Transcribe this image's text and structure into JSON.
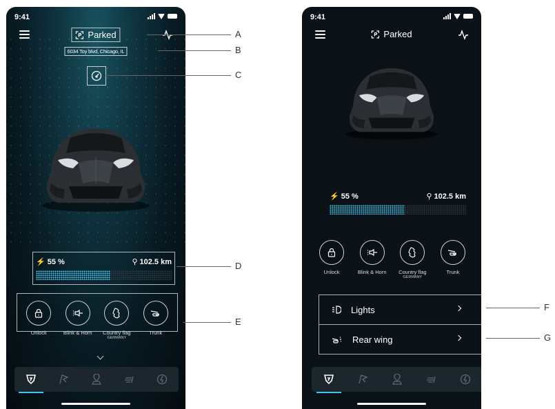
{
  "left_screen": {
    "status_bar": {
      "time": "9:41"
    },
    "header": {
      "status": "Parked",
      "address": "6034 Toy blvd, Chicago, IL"
    },
    "battery": {
      "charge": "55 %",
      "range": "102.5 km",
      "fill_fraction": 0.55
    },
    "actions": [
      {
        "label": "Unlock",
        "sub": "",
        "icon": "lock-icon"
      },
      {
        "label": "Blink & Horn",
        "sub": "",
        "icon": "horn-icon"
      },
      {
        "label": "Country flag",
        "sub": "GERMANY",
        "icon": "country-shape-icon"
      },
      {
        "label": "Trunk",
        "sub": "",
        "icon": "trunk-icon"
      }
    ],
    "tabs": [
      "home-icon",
      "flag-icon",
      "location-icon",
      "wind-icon",
      "charge-icon"
    ],
    "active_tab": 0
  },
  "right_screen": {
    "status_bar": {
      "time": "9:41"
    },
    "header": {
      "status": "Parked"
    },
    "battery": {
      "charge": "55 %",
      "range": "102.5 km",
      "fill_fraction": 0.55
    },
    "actions": [
      {
        "label": "Unlock",
        "sub": "",
        "icon": "lock-icon"
      },
      {
        "label": "Blink & Horn",
        "sub": "",
        "icon": "horn-icon"
      },
      {
        "label": "Country flag",
        "sub": "GERMANY",
        "icon": "country-shape-icon"
      },
      {
        "label": "Trunk",
        "sub": "",
        "icon": "trunk-icon"
      }
    ],
    "menu": [
      {
        "label": "Lights",
        "icon": "headlight-icon"
      },
      {
        "label": "Rear wing",
        "icon": "rear-wing-icon"
      }
    ],
    "tabs": [
      "home-icon",
      "flag-icon",
      "location-icon",
      "wind-icon",
      "charge-icon"
    ],
    "active_tab": 0
  },
  "callouts": [
    "A",
    "B",
    "C",
    "D",
    "E",
    "F",
    "G"
  ],
  "colors": {
    "accent": "#46c4ea",
    "bg_dark": "#0b1217",
    "bg_teal": "#0f3440"
  }
}
